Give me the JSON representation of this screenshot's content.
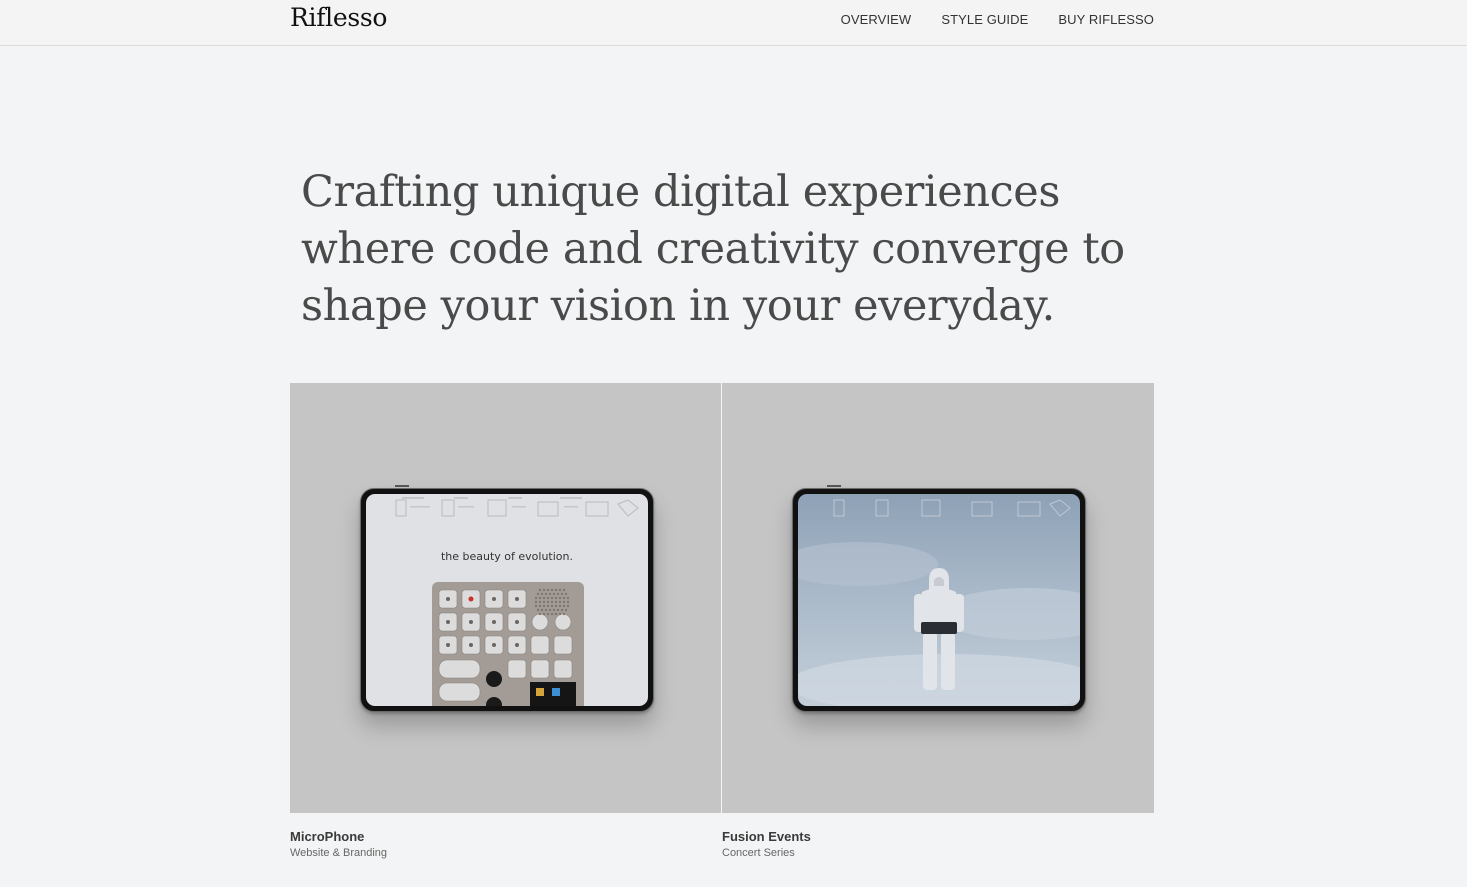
{
  "header": {
    "brand": "Riflesso",
    "nav": [
      "OVERVIEW",
      "STYLE GUIDE",
      "BUY RIFLESSO"
    ]
  },
  "hero": {
    "headline": "Crafting unique digital experiences where code and creativity converge to shape your vision in your everyday."
  },
  "projects": [
    {
      "title": "MicroPhone",
      "subtitle": "Website & Branding",
      "screen_text": "the beauty of evolution.",
      "icon": "keypad-device-illustration"
    },
    {
      "title": "Fusion Events",
      "subtitle": "Concert Series",
      "icon": "astronaut-sky-photo"
    }
  ],
  "colors": {
    "background": "#f3f4f5",
    "card_bg": "#c5c5c5",
    "headline": "#4a4a4a"
  }
}
